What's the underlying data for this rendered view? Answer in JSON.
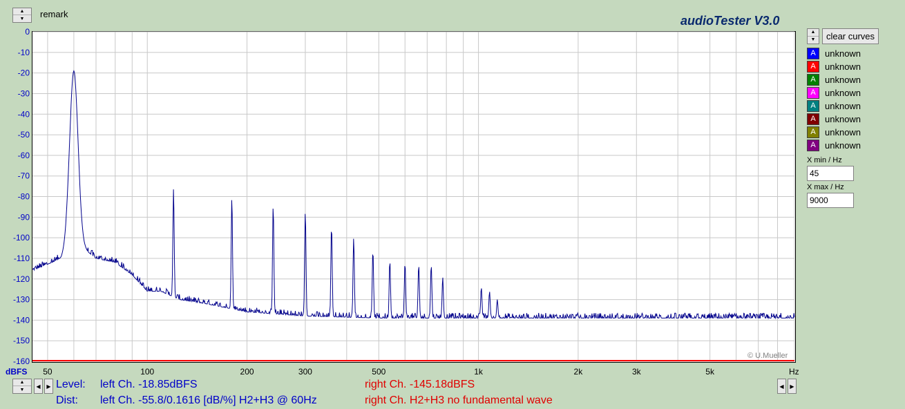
{
  "header": {
    "remark": "remark",
    "app_title": "audioTester  V3.0"
  },
  "controls": {
    "clear_curves": "clear curves",
    "curves": [
      {
        "label": "unknown",
        "color": "#0000ff"
      },
      {
        "label": "unknown",
        "color": "#ff0000"
      },
      {
        "label": "unknown",
        "color": "#008000"
      },
      {
        "label": "unknown",
        "color": "#ff00ff"
      },
      {
        "label": "unknown",
        "color": "#008080"
      },
      {
        "label": "unknown",
        "color": "#800000"
      },
      {
        "label": "unknown",
        "color": "#808000"
      },
      {
        "label": "unknown",
        "color": "#800080"
      }
    ],
    "curve_glyph": "A",
    "x_min_label": "X min / Hz",
    "x_min_value": "45",
    "x_max_label": "X max / Hz",
    "x_max_value": "9000"
  },
  "status": {
    "level_label": "Level:",
    "level_left": "left Ch. -18.85dBFS",
    "level_right": "right Ch. -145.18dBFS",
    "dist_label": "Dist:",
    "dist_left": "left Ch. -55.8/0.1616 [dB/%] H2+H3 @ 60Hz",
    "dist_right": "right Ch. H2+H3 no fundamental wave"
  },
  "copyright": "© U.Mueller",
  "colors": {
    "left_trace": "#00008b",
    "right_trace": "#ff0000",
    "grid": "#c8c8c8"
  },
  "chart_data": {
    "type": "line",
    "title": "",
    "xlabel": "Hz",
    "ylabel": "dBFS",
    "xscale": "log",
    "xlim": [
      45,
      9000
    ],
    "ylim": [
      -160,
      0
    ],
    "yticks": [
      0,
      -10,
      -20,
      -30,
      -40,
      -50,
      -60,
      -70,
      -80,
      -90,
      -100,
      -110,
      -120,
      -130,
      -140,
      -150,
      -160
    ],
    "xticks": [
      {
        "value": 50,
        "label": "50"
      },
      {
        "value": 100,
        "label": "100"
      },
      {
        "value": 200,
        "label": "200"
      },
      {
        "value": 300,
        "label": "300"
      },
      {
        "value": 500,
        "label": "500"
      },
      {
        "value": 1000,
        "label": "1k"
      },
      {
        "value": 2000,
        "label": "2k"
      },
      {
        "value": 3000,
        "label": "3k"
      },
      {
        "value": 5000,
        "label": "5k"
      }
    ],
    "grid": true,
    "series": [
      {
        "channel": "left",
        "color": "#00008b",
        "fundamental": {
          "freq": 60,
          "level": -19
        },
        "harmonics": [
          {
            "freq": 120,
            "level": -76
          },
          {
            "freq": 180,
            "level": -80
          },
          {
            "freq": 240,
            "level": -84
          },
          {
            "freq": 300,
            "level": -87
          },
          {
            "freq": 360,
            "level": -94
          },
          {
            "freq": 420,
            "level": -100
          },
          {
            "freq": 480,
            "level": -106
          },
          {
            "freq": 540,
            "level": -111
          },
          {
            "freq": 600,
            "level": -112
          },
          {
            "freq": 660,
            "level": -113
          },
          {
            "freq": 720,
            "level": -113
          },
          {
            "freq": 780,
            "level": -119
          },
          {
            "freq": 1020,
            "level": -124
          },
          {
            "freq": 1080,
            "level": -126
          },
          {
            "freq": 1140,
            "level": -130
          }
        ],
        "noise_floor": [
          [
            45,
            -116
          ],
          [
            55,
            -110
          ],
          [
            58,
            -105
          ],
          [
            65,
            -106
          ],
          [
            70,
            -110
          ],
          [
            80,
            -112
          ],
          [
            90,
            -118
          ],
          [
            100,
            -126
          ],
          [
            110,
            -126
          ],
          [
            125,
            -130
          ],
          [
            150,
            -132
          ],
          [
            200,
            -136
          ],
          [
            300,
            -138
          ],
          [
            500,
            -139
          ],
          [
            1000,
            -139
          ],
          [
            2000,
            -139
          ],
          [
            5000,
            -139
          ],
          [
            9000,
            -139
          ]
        ]
      },
      {
        "channel": "right",
        "color": "#ff0000",
        "level": -160
      }
    ]
  }
}
